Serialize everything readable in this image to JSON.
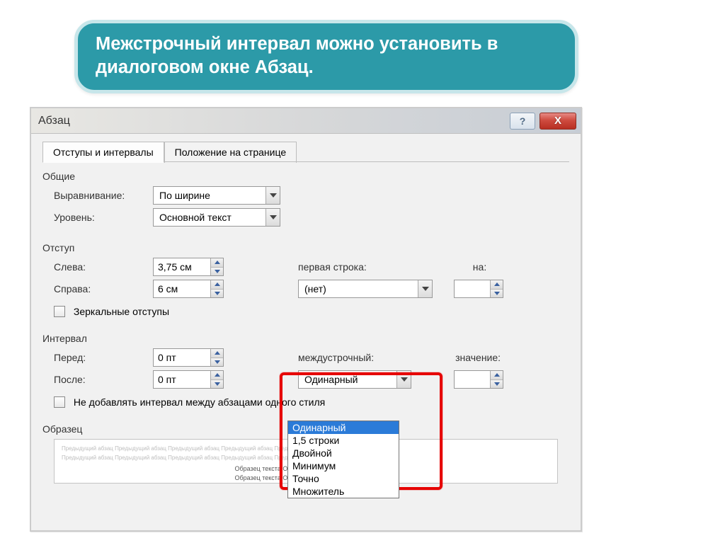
{
  "banner": {
    "text": "Межстрочный интервал можно установить в диалоговом окне Абзац."
  },
  "dialog": {
    "title": "Абзац",
    "help_btn": "?",
    "close_btn": "X",
    "tabs": {
      "indents": "Отступы и интервалы",
      "position": "Положение на странице"
    },
    "sections": {
      "general": "Общие",
      "indent": "Отступ",
      "spacing": "Интервал",
      "preview": "Образец"
    },
    "labels": {
      "alignment": "Выравнивание:",
      "level": "Уровень:",
      "left": "Слева:",
      "right": "Справа:",
      "first_line": "первая строка:",
      "by": "на:",
      "mirror": "Зеркальные отступы",
      "before": "Перед:",
      "after": "После:",
      "line_spacing": "междустрочный:",
      "value": "значение:",
      "no_space": "Не добавлять интервал между абзацами одного стиля"
    },
    "values": {
      "alignment": "По ширине",
      "level": "Основной текст",
      "left": "3,75 см",
      "right": "6 см",
      "first_line": "(нет)",
      "by": "",
      "before": "0 пт",
      "after": "0 пт",
      "line_spacing": "Одинарный",
      "value": ""
    },
    "line_spacing_options": [
      "Одинарный",
      "1,5 строки",
      "Двойной",
      "Минимум",
      "Точно",
      "Множитель"
    ],
    "preview": {
      "grey_line": "Предыдущий абзац Предыдущий абзац Предыдущий абзац Предыдущий абзац Предыдущий абзац",
      "sample_line": "Образец текста Образец текста Образец текста"
    }
  }
}
